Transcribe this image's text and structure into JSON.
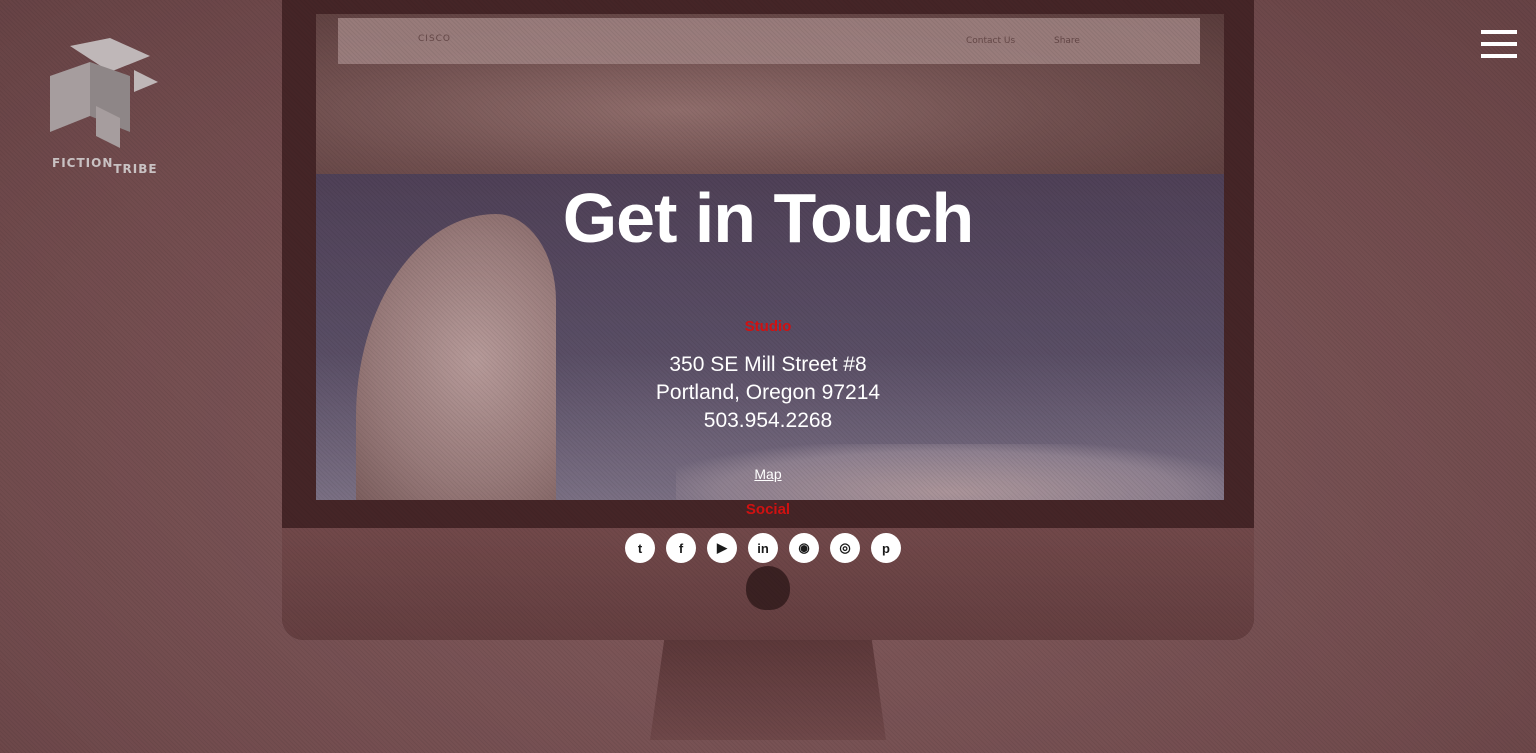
{
  "brand": {
    "line1": "FICTION",
    "line2": "TRIBE"
  },
  "screen_content": {
    "cisco_label": "CISCO",
    "contact_label": "Contact Us",
    "share_label": "Share"
  },
  "main": {
    "title": "Get in Touch",
    "studio_label": "Studio",
    "address_line1": "350 SE Mill Street #8",
    "address_line2": "Portland, Oregon 97214",
    "phone": "503.954.2268",
    "map_link": "Map",
    "social_label": "Social"
  },
  "social_icons": [
    {
      "name": "twitter-icon",
      "glyph": "t"
    },
    {
      "name": "facebook-icon",
      "glyph": "f"
    },
    {
      "name": "youtube-icon",
      "glyph": "▶"
    },
    {
      "name": "linkedin-icon",
      "glyph": "in"
    },
    {
      "name": "github-icon",
      "glyph": "◉"
    },
    {
      "name": "instagram-icon",
      "glyph": "◎"
    },
    {
      "name": "pinterest-icon",
      "glyph": "p"
    }
  ],
  "colors": {
    "accent": "#d11111",
    "text": "#ffffff",
    "tint": "#784648"
  }
}
